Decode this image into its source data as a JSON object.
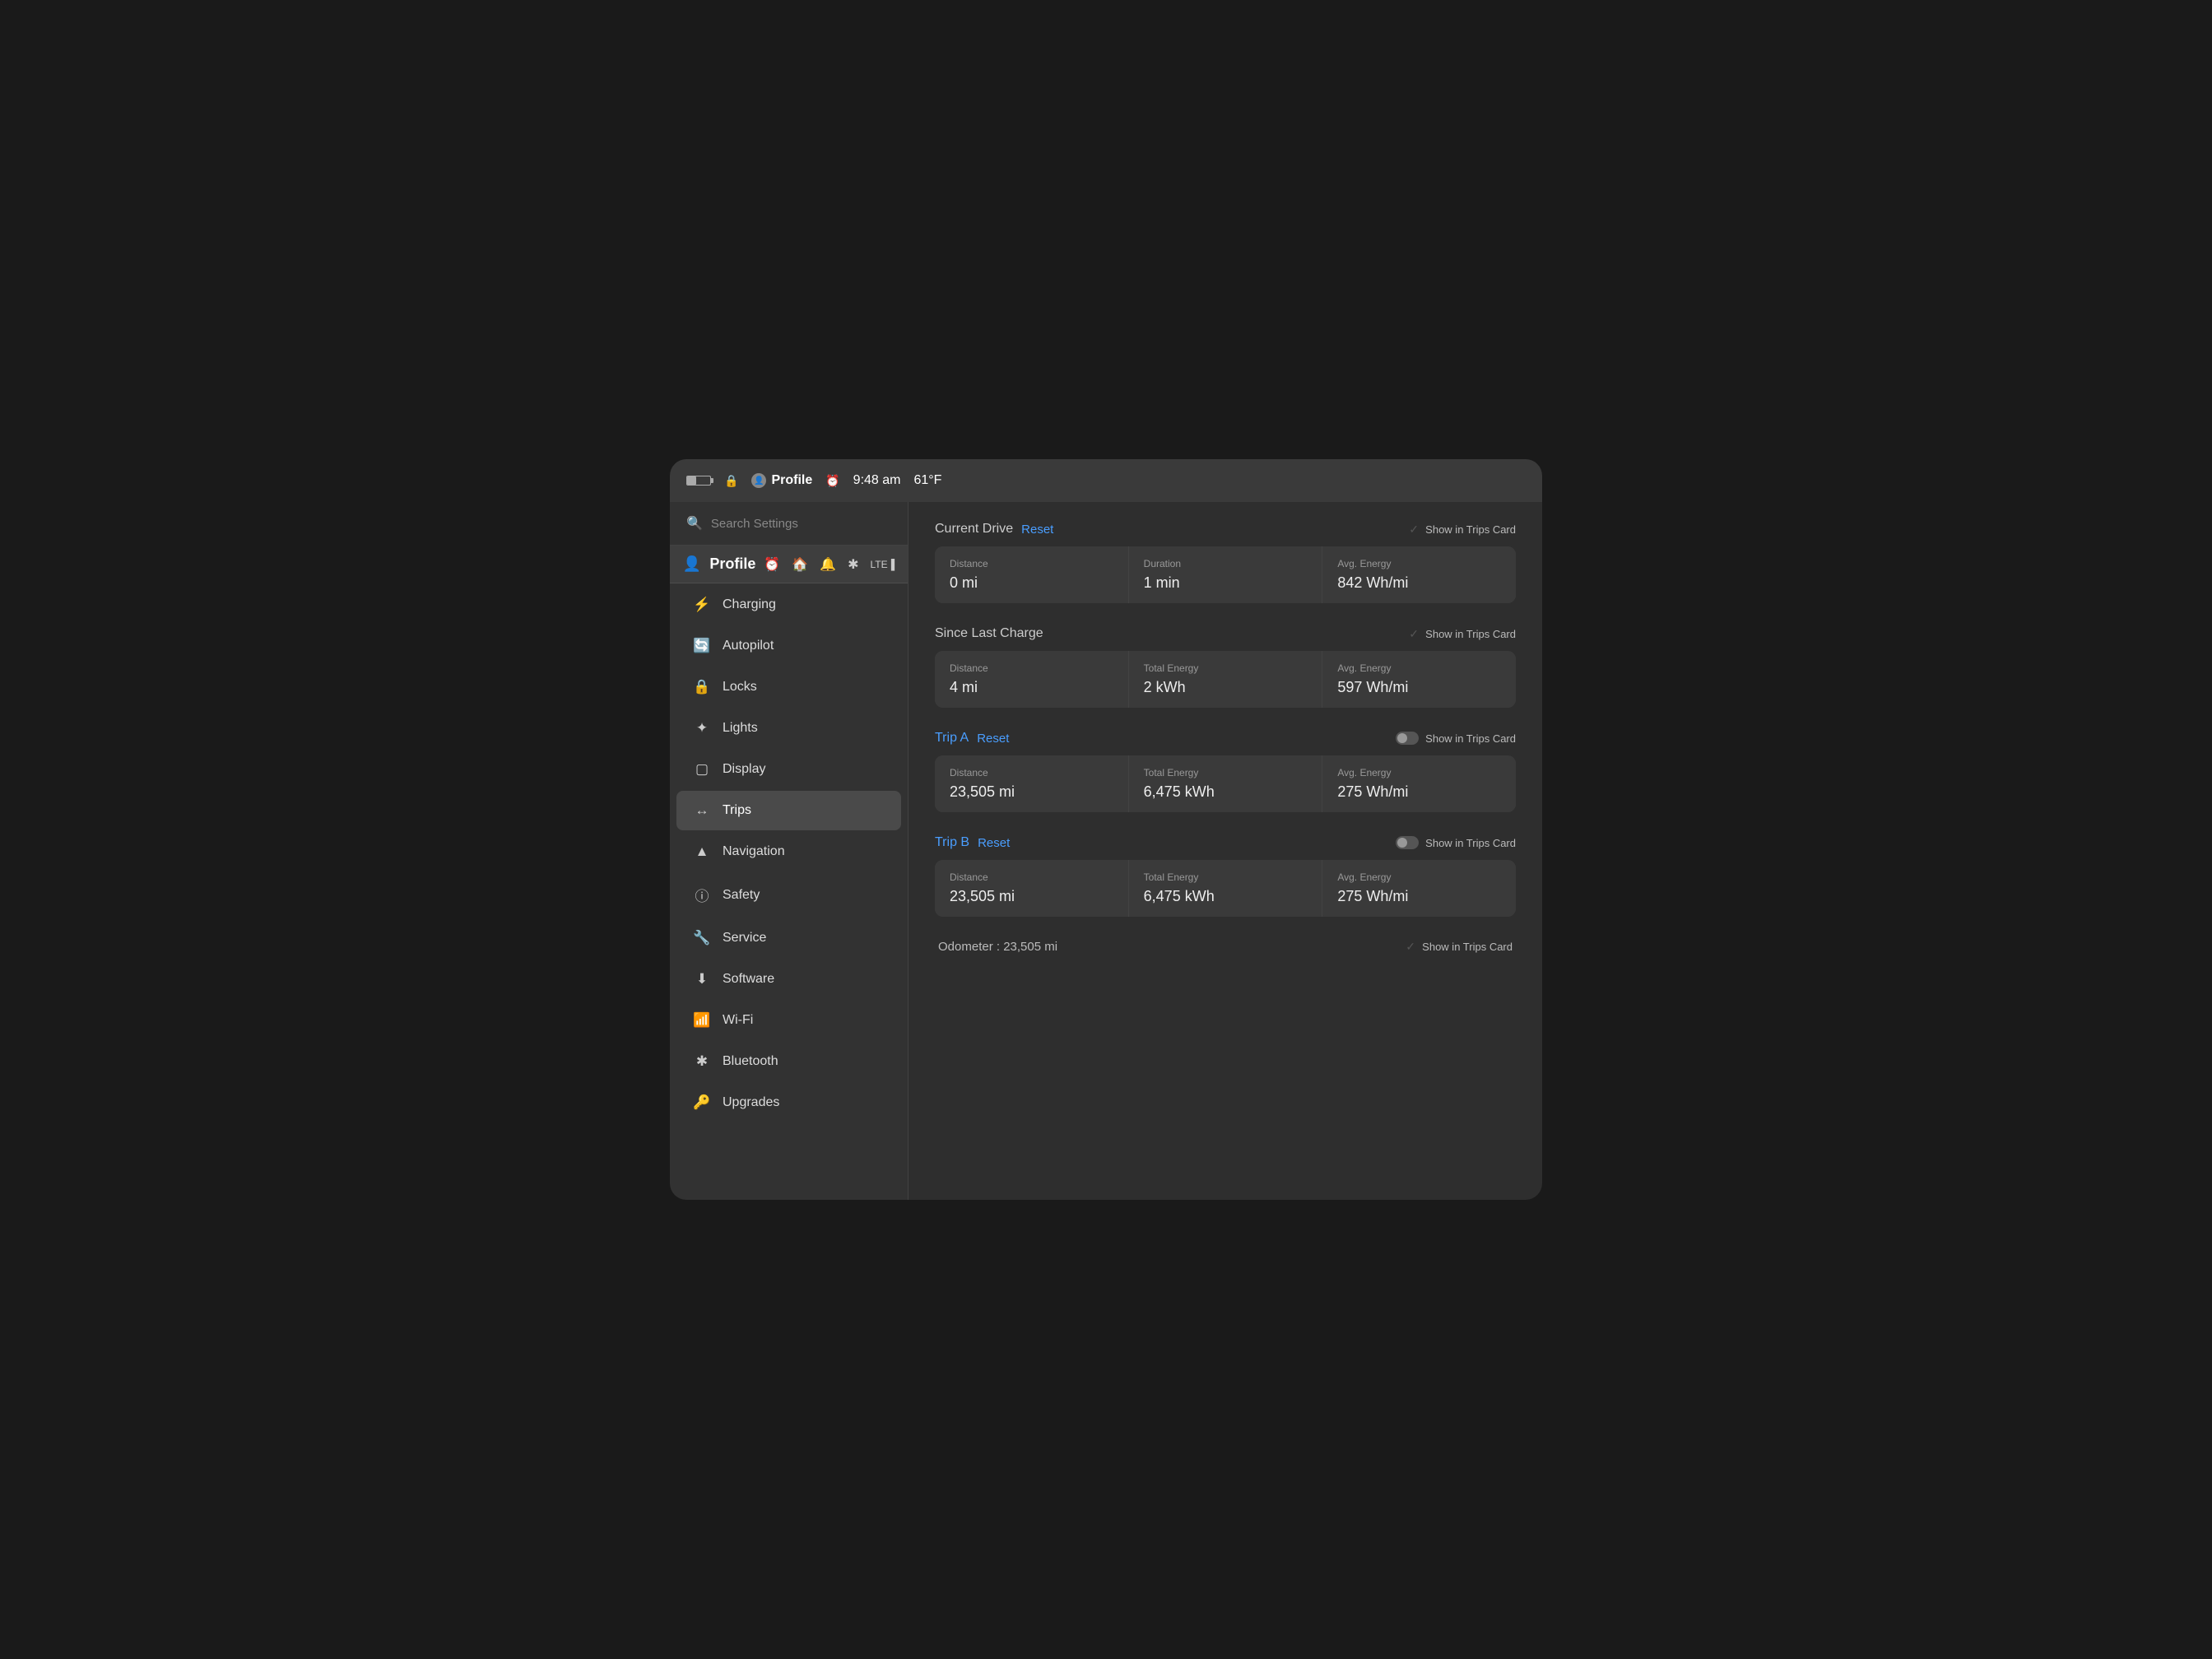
{
  "statusBar": {
    "profileLabel": "Profile",
    "time": "9:48 am",
    "temperature": "61°F"
  },
  "navHeader": {
    "profileLabel": "Profile"
  },
  "search": {
    "placeholder": "Search Settings"
  },
  "sidebar": {
    "items": [
      {
        "id": "charging",
        "label": "Charging",
        "icon": "⚡"
      },
      {
        "id": "autopilot",
        "label": "Autopilot",
        "icon": "🔄"
      },
      {
        "id": "locks",
        "label": "Locks",
        "icon": "🔒"
      },
      {
        "id": "lights",
        "label": "Lights",
        "icon": "✦"
      },
      {
        "id": "display",
        "label": "Display",
        "icon": "▢"
      },
      {
        "id": "trips",
        "label": "Trips",
        "icon": "↔",
        "active": true
      },
      {
        "id": "navigation",
        "label": "Navigation",
        "icon": "▲"
      },
      {
        "id": "safety",
        "label": "Safety",
        "icon": "ⓘ"
      },
      {
        "id": "service",
        "label": "Service",
        "icon": "🔧"
      },
      {
        "id": "software",
        "label": "Software",
        "icon": "⬇"
      },
      {
        "id": "wifi",
        "label": "Wi-Fi",
        "icon": "📶"
      },
      {
        "id": "bluetooth",
        "label": "Bluetooth",
        "icon": "✱"
      },
      {
        "id": "upgrades",
        "label": "Upgrades",
        "icon": "🔑"
      }
    ]
  },
  "content": {
    "currentDrive": {
      "title": "Current Drive",
      "resetLabel": "Reset",
      "showInTrips": "Show in Trips Card",
      "showInTripsChecked": true,
      "stats": [
        {
          "label": "Distance",
          "value": "0 mi"
        },
        {
          "label": "Duration",
          "value": "1 min"
        },
        {
          "label": "Avg. Energy",
          "value": "842 Wh/mi"
        }
      ]
    },
    "sinceLastCharge": {
      "title": "Since Last Charge",
      "showInTrips": "Show in Trips Card",
      "showInTripsChecked": true,
      "stats": [
        {
          "label": "Distance",
          "value": "4 mi"
        },
        {
          "label": "Total Energy",
          "value": "2 kWh"
        },
        {
          "label": "Avg. Energy",
          "value": "597 Wh/mi"
        }
      ]
    },
    "tripA": {
      "title": "Trip A",
      "resetLabel": "Reset",
      "showInTrips": "Show in Trips Card",
      "showInTripsChecked": false,
      "stats": [
        {
          "label": "Distance",
          "value": "23,505 mi"
        },
        {
          "label": "Total Energy",
          "value": "6,475 kWh"
        },
        {
          "label": "Avg. Energy",
          "value": "275 Wh/mi"
        }
      ]
    },
    "tripB": {
      "title": "Trip B",
      "resetLabel": "Reset",
      "showInTrips": "Show in Trips Card",
      "showInTripsChecked": false,
      "stats": [
        {
          "label": "Distance",
          "value": "23,505 mi"
        },
        {
          "label": "Total Energy",
          "value": "6,475 kWh"
        },
        {
          "label": "Avg. Energy",
          "value": "275 Wh/mi"
        }
      ]
    },
    "odometer": {
      "label": "Odometer : 23,505 mi",
      "showInTrips": "Show in Trips Card",
      "showInTripsChecked": true
    }
  },
  "dock": {
    "items": [
      {
        "id": "music",
        "icon": "♪",
        "color": "red"
      },
      {
        "id": "circle",
        "icon": "⊙",
        "color": "default"
      },
      {
        "id": "bluetooth",
        "icon": "✱",
        "color": "blue"
      },
      {
        "id": "chat",
        "icon": "💬",
        "color": "blue2"
      },
      {
        "id": "volume",
        "icon": "🔊",
        "color": "default"
      }
    ]
  }
}
